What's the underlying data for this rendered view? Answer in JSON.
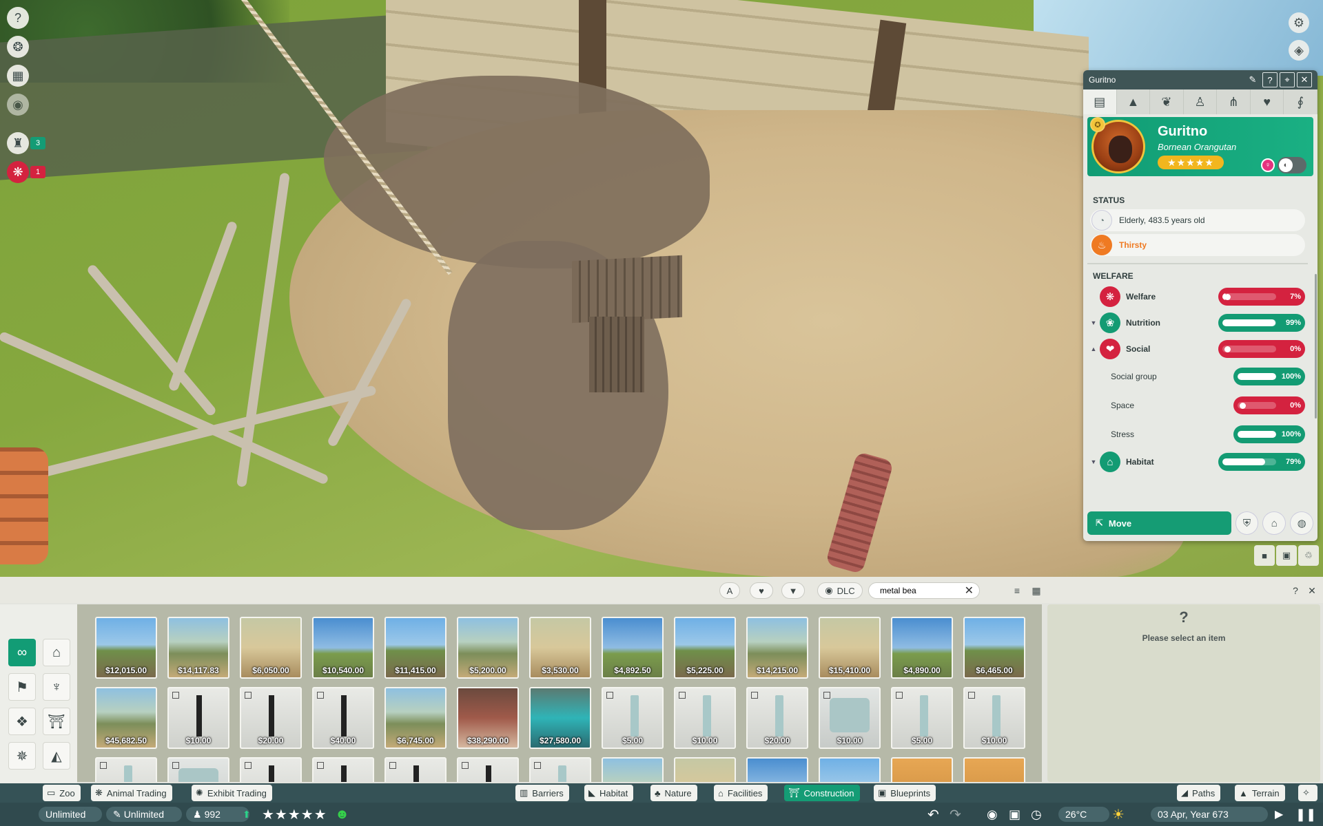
{
  "left_toolbar": {
    "icons": [
      "help-icon",
      "animal-book-icon",
      "calendar-icon",
      "visibility-icon",
      "zookeeper-icon",
      "paw-icon"
    ],
    "zookeeper_count": "3",
    "animal_alert_count": "1"
  },
  "animal_panel": {
    "window_title": "Guritno",
    "name": "Guritno",
    "species": "Bornean Orangutan",
    "stars": "★★★★★",
    "status_label": "STATUS",
    "status": [
      {
        "icon": "age-icon",
        "text": "Elderly, 483.5 years old",
        "color": "#7b8b8b"
      },
      {
        "icon": "thirst-icon",
        "text": "Thirsty",
        "color": "#ef7a22"
      }
    ],
    "welfare_label": "WELFARE",
    "welfare": [
      {
        "key": "welfare",
        "label": "Welfare",
        "value": 7,
        "pct": "7%",
        "level": "red",
        "sub": false,
        "caret": ""
      },
      {
        "key": "nutrition",
        "label": "Nutrition",
        "value": 99,
        "pct": "99%",
        "level": "green",
        "sub": false,
        "caret": "▼"
      },
      {
        "key": "social",
        "label": "Social",
        "value": 0,
        "pct": "0%",
        "level": "red",
        "sub": false,
        "caret": "▲"
      },
      {
        "key": "social-group",
        "label": "Social group",
        "value": 100,
        "pct": "100%",
        "level": "green",
        "sub": true,
        "caret": ""
      },
      {
        "key": "space",
        "label": "Space",
        "value": 0,
        "pct": "0%",
        "level": "red",
        "sub": true,
        "caret": ""
      },
      {
        "key": "stress",
        "label": "Stress",
        "value": 100,
        "pct": "100%",
        "level": "green",
        "sub": true,
        "caret": ""
      },
      {
        "key": "habitat",
        "label": "Habitat",
        "value": 79,
        "pct": "79%",
        "level": "green",
        "sub": false,
        "caret": "▼"
      }
    ],
    "move_label": "Move"
  },
  "browser": {
    "dlc_label": "DLC",
    "search_value": "metal bea",
    "info_question": "?",
    "info_message": "Please select an item",
    "rows": [
      [
        {
          "price": "$12,015.00",
          "thumb": "scene"
        },
        {
          "price": "$14,117.83",
          "thumb": "scene"
        },
        {
          "price": "$6,050.00",
          "thumb": "scene"
        },
        {
          "price": "$10,540.00",
          "thumb": "scene"
        },
        {
          "price": "$11,415.00",
          "thumb": "scene"
        },
        {
          "price": "$5,200.00",
          "thumb": "scene"
        },
        {
          "price": "$3,530.00",
          "thumb": "scene"
        },
        {
          "price": "$4,892.50",
          "thumb": "scene"
        },
        {
          "price": "$5,225.00",
          "thumb": "scene"
        },
        {
          "price": "$14,215.00",
          "thumb": "scene"
        },
        {
          "price": "$15,410.00",
          "thumb": "scene"
        },
        {
          "price": "$4,890.00",
          "thumb": "scene"
        },
        {
          "price": "$6,465.00",
          "thumb": "scene"
        }
      ],
      [
        {
          "price": "$45,682.50",
          "thumb": "scene"
        },
        {
          "price": "$10.00",
          "thumb": "post"
        },
        {
          "price": "$20.00",
          "thumb": "post"
        },
        {
          "price": "$40.00",
          "thumb": "post"
        },
        {
          "price": "$6,745.00",
          "thumb": "scene"
        },
        {
          "price": "$38,290.00",
          "thumb": "shop"
        },
        {
          "price": "$27,580.00",
          "thumb": "pool"
        },
        {
          "price": "$5.00",
          "thumb": "light"
        },
        {
          "price": "$10.00",
          "thumb": "light"
        },
        {
          "price": "$20.00",
          "thumb": "light"
        },
        {
          "price": "$10.00",
          "thumb": "cube"
        },
        {
          "price": "$5.00",
          "thumb": "light"
        },
        {
          "price": "$10.00",
          "thumb": "light"
        }
      ],
      [
        {
          "price": "",
          "thumb": "light"
        },
        {
          "price": "",
          "thumb": "cube"
        },
        {
          "price": "",
          "thumb": "post"
        },
        {
          "price": "",
          "thumb": "post"
        },
        {
          "price": "",
          "thumb": "post"
        },
        {
          "price": "",
          "thumb": "post"
        },
        {
          "price": "",
          "thumb": "light"
        },
        {
          "price": "",
          "thumb": "scene"
        },
        {
          "price": "",
          "thumb": "scene"
        },
        {
          "price": "",
          "thumb": "scene"
        },
        {
          "price": "",
          "thumb": "scene"
        },
        {
          "price": "",
          "thumb": "sand"
        },
        {
          "price": "",
          "thumb": "sand"
        }
      ]
    ]
  },
  "tabs": {
    "zoo": "Zoo",
    "animal_trading": "Animal Trading",
    "exhibit_trading": "Exhibit Trading",
    "barriers": "Barriers",
    "habitat": "Habitat",
    "nature": "Nature",
    "facilities": "Facilities",
    "construction": "Construction",
    "blueprints": "Blueprints",
    "paths": "Paths",
    "terrain": "Terrain"
  },
  "status_bar": {
    "money": "Unlimited",
    "research": "Unlimited",
    "guests": "992",
    "rating": "★★★★★",
    "temperature": "26°C",
    "date": "03 Apr, Year 673"
  }
}
